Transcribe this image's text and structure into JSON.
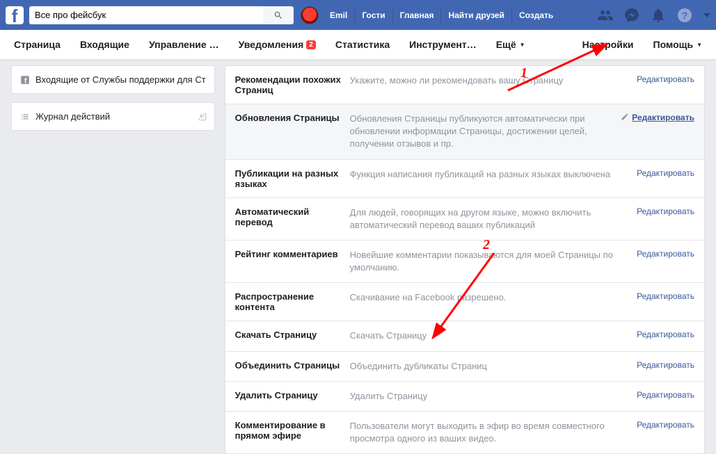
{
  "top": {
    "search_value": "Все про фейсбук",
    "user_name": "Emil",
    "links": [
      "Гости",
      "Главная",
      "Найти друзей",
      "Создать"
    ]
  },
  "subnav": {
    "items": [
      "Страница",
      "Входящие",
      "Управление …",
      "Уведомления",
      "Статистика",
      "Инструмент…",
      "Ещё"
    ],
    "badge": "2",
    "right": {
      "settings": "Настройки",
      "help": "Помощь"
    }
  },
  "left": {
    "inbox": "Входящие от Службы поддержки для Ст",
    "activity": "Журнал действий"
  },
  "rows": [
    {
      "label": "Рекомендации похожих Страниц",
      "desc": "Укажите, можно ли рекомендовать вашу Страницу",
      "edit": "Редактировать"
    },
    {
      "label": "Обновления Страницы",
      "desc": "Обновления Страницы публикуются автоматически при обновлении информации Страницы, достижении целей, получении отзывов и пр.",
      "edit": "Редактировать",
      "sel": true,
      "pencil": true
    },
    {
      "label": "Публикации на разных языках",
      "desc": "Функция написания публикаций на разных языках выключена",
      "edit": "Редактировать"
    },
    {
      "label": "Автоматический перевод",
      "desc": "Для людей, говорящих на другом языке, можно включить автоматический перевод ваших публикаций",
      "edit": "Редактировать"
    },
    {
      "label": "Рейтинг комментариев",
      "desc": "Новейшие комментарии показываются для моей Страницы по умолчанию.",
      "edit": "Редактировать"
    },
    {
      "label": "Распространение контента",
      "desc": "Скачивание на Facebook разрешено.",
      "edit": "Редактировать"
    },
    {
      "label": "Скачать Страницу",
      "desc": "Скачать Страницу",
      "edit": "Редактировать"
    },
    {
      "label": "Объединить Страницы",
      "desc": "Объединить дубликаты Страниц",
      "edit": "Редактировать"
    },
    {
      "label": "Удалить Страницу",
      "desc": "Удалить Страницу",
      "edit": "Редактировать"
    },
    {
      "label": "Комментирование в прямом эфире",
      "desc": "Пользователи могут выходить в эфир во время совместного просмотра одного из ваших видео.",
      "edit": "Редактировать"
    }
  ],
  "annotations": {
    "one": "1",
    "two": "2"
  }
}
